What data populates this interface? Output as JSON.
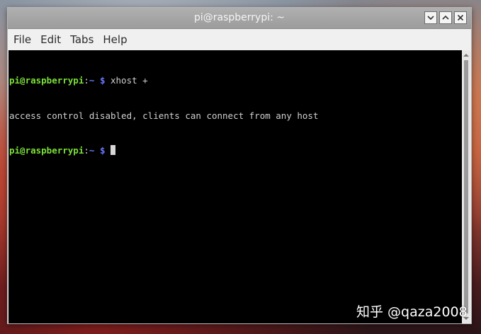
{
  "window": {
    "title": "pi@raspberrypi: ~",
    "buttons": {
      "minimize_icon": "minimize-icon",
      "maximize_icon": "maximize-icon",
      "close_icon": "close-icon"
    }
  },
  "menubar": {
    "items": [
      {
        "label": "File"
      },
      {
        "label": "Edit"
      },
      {
        "label": "Tabs"
      },
      {
        "label": "Help"
      }
    ]
  },
  "terminal": {
    "lines": [
      {
        "prompt_user": "pi@raspberrypi",
        "prompt_colon": ":",
        "prompt_path": "~ $",
        "command": " xhost +"
      },
      {
        "output": "access control disabled, clients can connect from any host"
      },
      {
        "prompt_user": "pi@raspberrypi",
        "prompt_colon": ":",
        "prompt_path": "~ $",
        "command": " "
      }
    ],
    "colors": {
      "background": "#000000",
      "prompt_user": "#7ce03a",
      "prompt_path": "#6c78ff",
      "text": "#d0d0d0"
    }
  },
  "watermark": {
    "text": "知乎 @qaza2008"
  }
}
